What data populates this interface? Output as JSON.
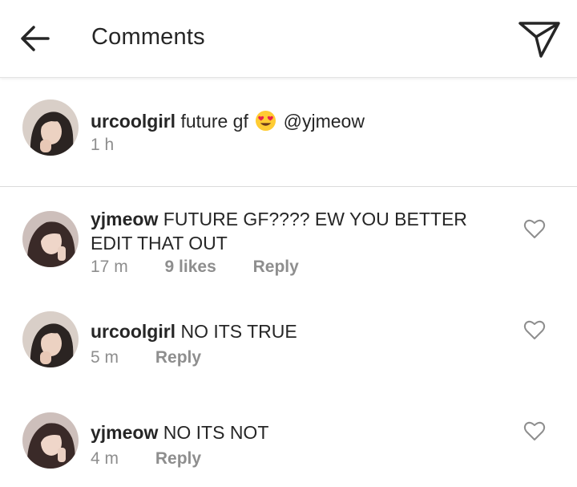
{
  "header": {
    "title": "Comments",
    "back_icon": "arrow-left-icon",
    "send_icon": "paper-plane-icon"
  },
  "caption": {
    "username": "urcoolgirl",
    "text_before": "future gf",
    "emoji": "heart-eyes-emoji",
    "mention": "@yjmeow",
    "time": "1 h"
  },
  "comments": [
    {
      "username": "yjmeow",
      "text": "FUTURE GF???? EW YOU BETTER EDIT THAT OUT",
      "time": "17 m",
      "likes": "9 likes",
      "reply": "Reply"
    },
    {
      "username": "urcoolgirl",
      "text": "NO ITS TRUE",
      "time": "5 m",
      "reply": "Reply"
    },
    {
      "username": "yjmeow",
      "text": "NO ITS NOT",
      "time": "4 m",
      "reply": "Reply"
    }
  ],
  "colors": {
    "text": "#262626",
    "meta": "#8e8e8e",
    "divider": "#dbdbdb",
    "emoji": "#ffcc33"
  }
}
